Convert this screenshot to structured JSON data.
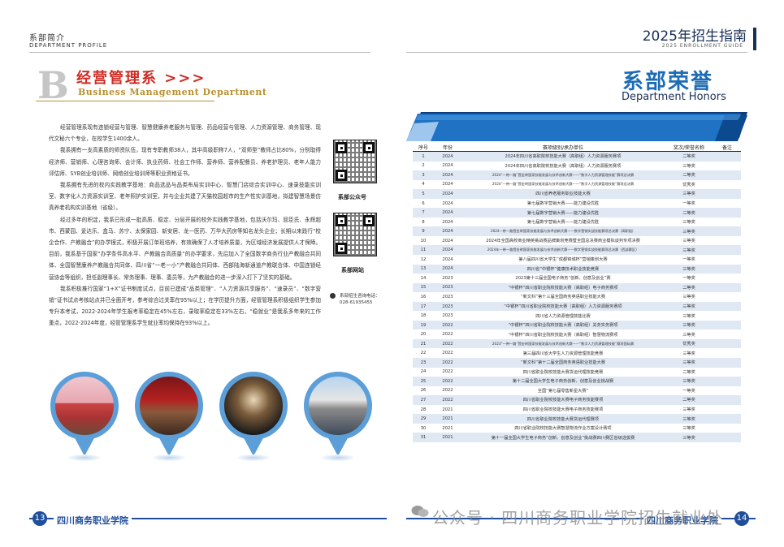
{
  "header": {
    "left_cn": "系部简介",
    "left_en": "DEPARTMENT PROFILE",
    "right_cn": "2025年招生指南",
    "right_en": "2025 ENROLLMENT GUIDE"
  },
  "department": {
    "letter": "B",
    "title_cn": "经营管理系 >>>",
    "title_en": "Business Management Department",
    "paragraphs": [
      "经营管理系现有连锁经营与管理、智慧健康养老服务与管理、药品经营与管理、人力资源管理、商务管理、现代文秘六个专业，在校学生1400余人。",
      "我系拥有一支高素质的师资队伍，现有专职教师38人，其中高级职称7人，“双师型”教师占比80%，分别取得经济师、营销师、心理咨询师、会计师、执业药师、社会工作师、营养师、营养配餐员、养老护理员、老年人能力评估师、SYB创业培训师、网络创业培训师等职业资格证书。",
      "我系拥有先进的校内实践教学基地：商品选品与品类布局实训中心、智慧门店综合实训中心、速录技能实训室、数字化人力资源实训室、老年照护实训室，并与企业共建了天猫校园超市的生产性实训基地，拟建智慧场景仿真养老机构实训基地（省级）。",
      "经过多年的积淀，我系已形成一批高质、稳定、分层开展的校外实践教学基地，包括沃尔玛、屈臣氏、永辉超市、西蒙园、爱达乐、盒马、苏宁、太保家园、新安居、龙一医药、万华大药房等知名龙头企业；长期以来践行“校企合作、产教融合”的办学模式，积极开展订单班培养，有效确保了人才培养质量，为区域经济发展提供人才保障。目前，我系基于国家“办学条件高水平、产教融合高质量”的办学要求，先后加入了全国数字商务行业产教融合共同体、全国智慧康养产教融合共同体、四川省“一老一小”产教融合共同体、西部陆海新通道产教联合体、中国连锁经营协会等组织，担任副理事长、常务理事、理事、委员等，为产教融合的进一步深入打下了坚实的基础。",
      "我系积极推行国家“1+X”证书制度试点，目前已建成“品类管理”、“人力资源共享服务”、“速录员”、“数字营销”证书试点考核站点并已全面开考，参考综合过关率在95%以上；在学历提升方面，经管管理系积极组织学生参加专升本考试，2022-2024年学生报考率稳定在45%左右，录取率稳定在33%左右，“稳就业”是我系多年来的工作重点，2022-2024年度，经管管理系学生就业率均保持在93%以上。"
    ]
  },
  "qr": {
    "wechat_label": "系部公众号",
    "site_label": "系部网站",
    "phone_label": "系部招生咨询电话：",
    "phone": "028-61935455"
  },
  "honors": {
    "title_cn": "系部荣誉",
    "title_en": "Department Honors",
    "columns": [
      "序号",
      "年份",
      "赛项级别/承办单位",
      "奖次/荣誉名称",
      "备注"
    ],
    "rows": [
      [
        "1",
        "2024",
        "2024年四川省高职院校技能大赛（高职组）人力资源服务赛项",
        "二等奖",
        ""
      ],
      [
        "2",
        "2024",
        "2024年四川省高职院校技能大赛（高职组）人力资源服务赛项",
        "三等奖",
        ""
      ],
      [
        "3",
        "2024",
        "2024“一带一路”暨金砖国家技能发展与技术创新大赛——“数字人力资源管理技能”赛项总决赛",
        "二等奖",
        ""
      ],
      [
        "4",
        "2024",
        "2024“一带一路”暨金砖国家技能发展与技术创新大赛——“数字人力资源管理技能”赛项总决赛",
        "优秀奖",
        ""
      ],
      [
        "5",
        "2024",
        "四川省养老服务职业技能大赛",
        "三等奖",
        ""
      ],
      [
        "6",
        "2024",
        "第七届数字营销大赛——能力建设优胜",
        "一等奖",
        ""
      ],
      [
        "7",
        "2024",
        "第七届数字营销大赛——能力建设优胜",
        "二等奖",
        ""
      ],
      [
        "8",
        "2024",
        "第七届数字营销大赛——能力建设优胜",
        "三等奖",
        ""
      ],
      [
        "9",
        "2024",
        "2024一带一路暨金砖国家技能发展与技术创新大赛——数字营销实战技能赛项总决赛（高职组）",
        "三等奖",
        ""
      ],
      [
        "10",
        "2024",
        "2024年全国高校商业精英挑战赛品牌策划竞赛暨全国总决赛商业模拟谈判专项决赛",
        "三等奖",
        ""
      ],
      [
        "11",
        "2024",
        "2024年一带一路暨金砖国家技能发展与技术创新大赛——数字营销实战技能赛项总决赛（西部赛区）",
        "三等奖",
        ""
      ],
      [
        "12",
        "2024",
        "第八届四川省大学生“成都锦城杯”营销策划大赛",
        "一等奖",
        ""
      ],
      [
        "13",
        "2024",
        "四川省“中银杯”健康技术职业技能竞赛",
        "三等奖",
        ""
      ],
      [
        "14",
        "2023",
        "2023第十三届全国电子商务“创新、创意及创业”赛",
        "一等奖",
        ""
      ],
      [
        "15",
        "2023",
        "“中银杯”四川省职业院校技能大赛（高职组）电子商务赛项",
        "二等奖",
        ""
      ],
      [
        "16",
        "2023",
        "“新文科”第十三届全国商务英语职业技能大赛",
        "三等奖",
        ""
      ],
      [
        "17",
        "2023",
        "“中银杯”四川省职业院校技能大赛（高职组）人力资源服务赛项",
        "三等奖",
        ""
      ],
      [
        "18",
        "2023",
        "四川省人力资源管理技能比赛",
        "三等奖",
        ""
      ],
      [
        "19",
        "2022",
        "“中银杯”四川省职业院校技能大赛（高职组）关务实务赛项",
        "三等奖",
        ""
      ],
      [
        "20",
        "2022",
        "“中银杯”四川省职业院校技能大赛（高职组）智慧物流赛项",
        "三等奖",
        ""
      ],
      [
        "21",
        "2022",
        "2023“一带一路”暨金砖国家技能发展与技术创新大赛——“数字人力资源管理技能”赛项国际赛",
        "优秀奖",
        ""
      ],
      [
        "22",
        "2022",
        "第三届四川省大学生人力资源管理技能竞赛",
        "三等奖",
        ""
      ],
      [
        "23",
        "2022",
        "“新文科”第十二届全国商务英语职业技能大赛",
        "三等奖",
        ""
      ],
      [
        "24",
        "2022",
        "四川省职业院校技能大赛货运代理技能竞赛",
        "二等奖",
        ""
      ],
      [
        "25",
        "2022",
        "第十二届全国大学生电子商务创新、创意及创业挑战赛",
        "三等奖",
        ""
      ],
      [
        "26",
        "2022",
        "全国“第七届零售新星大赛”",
        "一等奖",
        ""
      ],
      [
        "27",
        "2022",
        "四川省职业院校技能大赛电子商务技能赛项",
        "二等奖",
        ""
      ],
      [
        "28",
        "2021",
        "四川省职业院校技能大赛电子商务技能赛项",
        "三等奖",
        ""
      ],
      [
        "29",
        "2021",
        "四川省职业院校技能大赛货运代理赛项",
        "三等奖",
        ""
      ],
      [
        "30",
        "2021",
        "四川省职业院校技能大赛智慧物流作业方案设计赛项",
        "三等奖",
        ""
      ],
      [
        "31",
        "2021",
        "第十一届全国大学生电子商务“创新、创意及创业”挑战赛四川赛区省级选拔赛",
        "三等奖",
        ""
      ]
    ]
  },
  "footer": {
    "page_left": "13",
    "page_right": "14",
    "school": "四川商务职业学院"
  },
  "watermark": "公众号 · 四川商务职业学院招生就业处",
  "colors": {
    "accent_blue": "#1d6bb5",
    "navy": "#1a2f57",
    "red": "#d12a22",
    "gold": "#b8902f",
    "row_stripe": "#dfe8f3"
  }
}
